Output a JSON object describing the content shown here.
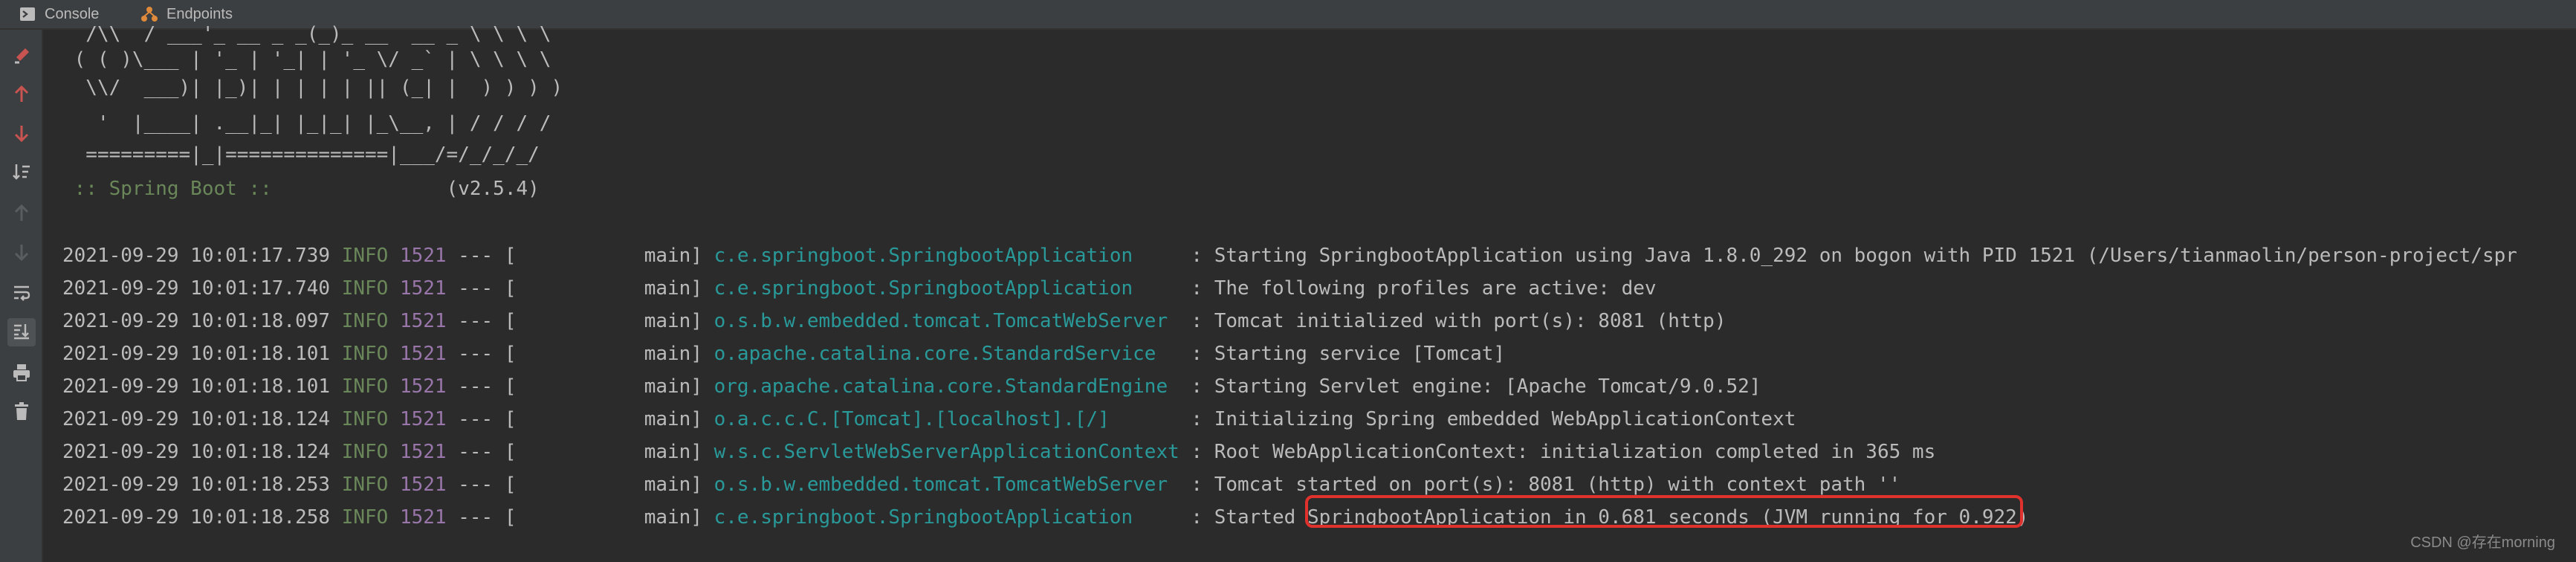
{
  "tabs": [
    {
      "label": "Console",
      "icon": "console-icon"
    },
    {
      "label": "Endpoints",
      "icon": "endpoints-icon"
    }
  ],
  "toolbar": [
    "clear-icon",
    "arrow-up-icon",
    "arrow-down-icon",
    "sort-icon",
    "up-disabled-icon",
    "down-disabled-icon",
    "soft-wrap-icon",
    "scroll-to-end-icon",
    "print-icon",
    "trash-icon"
  ],
  "banner": [
    "  /\\\\  / ___'_ __ _ _(_)_ __  __ _ \\ \\ \\ \\",
    " ( ( )\\___ | '_ | '_| | '_ \\/ _` | \\ \\ \\ \\",
    "  \\\\/  ___)| |_)| | | | | || (_| |  ) ) ) )",
    "   '  |____| .__|_| |_|_| |_\\__, | / / / /",
    "  =========|_|==============|___/=/_/_/_/"
  ],
  "spring_line": {
    "label": " :: Spring Boot ::",
    "version": "               (v2.5.4)"
  },
  "logs": [
    {
      "ts": "2021-09-29 10:01:17.739",
      "level": "INFO",
      "pid": "1521",
      "thread": " --- [           main] ",
      "logger": "c.e.springboot.SpringbootApplication    ",
      "msg": " : Starting SpringbootApplication using Java 1.8.0_292 on bogon with PID 1521 (/Users/tianmaolin/person-project/spr"
    },
    {
      "ts": "2021-09-29 10:01:17.740",
      "level": "INFO",
      "pid": "1521",
      "thread": " --- [           main] ",
      "logger": "c.e.springboot.SpringbootApplication    ",
      "msg": " : The following profiles are active: dev"
    },
    {
      "ts": "2021-09-29 10:01:18.097",
      "level": "INFO",
      "pid": "1521",
      "thread": " --- [           main] ",
      "logger": "o.s.b.w.embedded.tomcat.TomcatWebServer ",
      "msg": " : Tomcat initialized with port(s): 8081 (http)"
    },
    {
      "ts": "2021-09-29 10:01:18.101",
      "level": "INFO",
      "pid": "1521",
      "thread": " --- [           main] ",
      "logger": "o.apache.catalina.core.StandardService  ",
      "msg": " : Starting service [Tomcat]"
    },
    {
      "ts": "2021-09-29 10:01:18.101",
      "level": "INFO",
      "pid": "1521",
      "thread": " --- [           main] ",
      "logger": "org.apache.catalina.core.StandardEngine ",
      "msg": " : Starting Servlet engine: [Apache Tomcat/9.0.52]"
    },
    {
      "ts": "2021-09-29 10:01:18.124",
      "level": "INFO",
      "pid": "1521",
      "thread": " --- [           main] ",
      "logger": "o.a.c.c.C.[Tomcat].[localhost].[/]      ",
      "msg": " : Initializing Spring embedded WebApplicationContext"
    },
    {
      "ts": "2021-09-29 10:01:18.124",
      "level": "INFO",
      "pid": "1521",
      "thread": " --- [           main] ",
      "logger": "w.s.c.ServletWebServerApplicationContext",
      "msg": " : Root WebApplicationContext: initialization completed in 365 ms"
    },
    {
      "ts": "2021-09-29 10:01:18.253",
      "level": "INFO",
      "pid": "1521",
      "thread": " --- [           main] ",
      "logger": "o.s.b.w.embedded.tomcat.TomcatWebServer ",
      "msg": " : Tomcat started on port(s): 8081 (http) with context path ''"
    },
    {
      "ts": "2021-09-29 10:01:18.258",
      "level": "INFO",
      "pid": "1521",
      "thread": " --- [           main] ",
      "logger": "c.e.springboot.SpringbootApplication    ",
      "msg": " : Started SpringbootApplication in 0.681 seconds (JVM running for 0.922)"
    }
  ],
  "colors": {
    "background": "#2b2b2b",
    "text": "#bbbbbb",
    "level": "#6a8759",
    "pid": "#9876aa",
    "logger": "#299999",
    "highlight": "#e0312d"
  },
  "watermark": "CSDN @存在morning"
}
